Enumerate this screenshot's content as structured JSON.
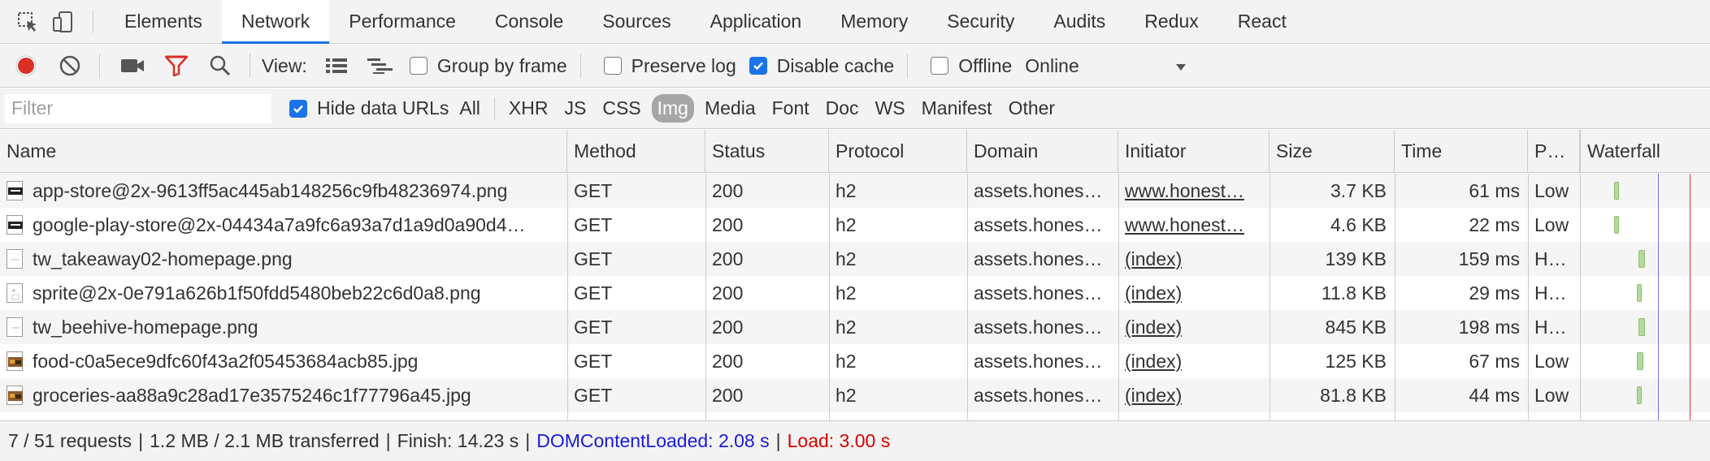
{
  "tabs": [
    {
      "label": "Elements"
    },
    {
      "label": "Network"
    },
    {
      "label": "Performance"
    },
    {
      "label": "Console"
    },
    {
      "label": "Sources"
    },
    {
      "label": "Application"
    },
    {
      "label": "Memory"
    },
    {
      "label": "Security"
    },
    {
      "label": "Audits"
    },
    {
      "label": "Redux"
    },
    {
      "label": "React"
    }
  ],
  "active_tab": "Network",
  "toolbar": {
    "view_label": "View:",
    "group_by_frame": "Group by frame",
    "preserve_log": "Preserve log",
    "disable_cache": "Disable cache",
    "offline": "Offline",
    "throttle_value": "Online",
    "group_by_frame_checked": false,
    "preserve_log_checked": false,
    "disable_cache_checked": true,
    "offline_checked": false
  },
  "filter": {
    "placeholder": "Filter",
    "hide_data_urls": "Hide data URLs",
    "hide_data_urls_checked": true,
    "types": [
      "All",
      "XHR",
      "JS",
      "CSS",
      "Img",
      "Media",
      "Font",
      "Doc",
      "WS",
      "Manifest",
      "Other"
    ],
    "active_type": "Img"
  },
  "columns": {
    "name": "Name",
    "method": "Method",
    "status": "Status",
    "protocol": "Protocol",
    "domain": "Domain",
    "initiator": "Initiator",
    "size": "Size",
    "time": "Time",
    "priority": "P…",
    "waterfall": "Waterfall"
  },
  "requests": [
    {
      "name": "app-store@2x-9613ff5ac445ab148256c9fb48236974.png",
      "method": "GET",
      "status": "200",
      "protocol": "h2",
      "domain": "assets.hones…",
      "initiator": "www.honest…",
      "initiator_link": true,
      "size": "3.7 KB",
      "time": "61 ms",
      "priority": "Low",
      "icon": "badge-thumbnail-icon"
    },
    {
      "name": "google-play-store@2x-04434a7a9fc6a93a7d1a9d0a90d4…",
      "method": "GET",
      "status": "200",
      "protocol": "h2",
      "domain": "assets.hones…",
      "initiator": "www.honest…",
      "initiator_link": true,
      "size": "4.6 KB",
      "time": "22 ms",
      "priority": "Low",
      "icon": "badge-thumbnail-icon"
    },
    {
      "name": "tw_takeaway02-homepage.png",
      "method": "GET",
      "status": "200",
      "protocol": "h2",
      "domain": "assets.hones…",
      "initiator": "(index)",
      "initiator_link": true,
      "size": "139 KB",
      "time": "159 ms",
      "priority": "H…",
      "icon": "blank-thumbnail-icon"
    },
    {
      "name": "sprite@2x-0e791a626b1f50fdd5480beb22c6d0a8.png",
      "method": "GET",
      "status": "200",
      "protocol": "h2",
      "domain": "assets.hones…",
      "initiator": "(index)",
      "initiator_link": true,
      "size": "11.8 KB",
      "time": "29 ms",
      "priority": "H…",
      "icon": "sprite-thumbnail-icon"
    },
    {
      "name": "tw_beehive-homepage.png",
      "method": "GET",
      "status": "200",
      "protocol": "h2",
      "domain": "assets.hones…",
      "initiator": "(index)",
      "initiator_link": true,
      "size": "845 KB",
      "time": "198 ms",
      "priority": "H…",
      "icon": "blank-thumbnail-icon"
    },
    {
      "name": "food-c0a5ece9dfc60f43a2f05453684acb85.jpg",
      "method": "GET",
      "status": "200",
      "protocol": "h2",
      "domain": "assets.hones…",
      "initiator": "(index)",
      "initiator_link": true,
      "size": "125 KB",
      "time": "67 ms",
      "priority": "Low",
      "icon": "photo-thumbnail-icon"
    },
    {
      "name": "groceries-aa88a9c28ad17e3575246c1f77796a45.jpg",
      "method": "GET",
      "status": "200",
      "protocol": "h2",
      "domain": "assets.hones…",
      "initiator": "(index)",
      "initiator_link": true,
      "size": "81.8 KB",
      "time": "44 ms",
      "priority": "Low",
      "icon": "photo-thumbnail-icon"
    }
  ],
  "status_bar": {
    "requests": "7 / 51 requests",
    "transferred": "1.2 MB / 2.1 MB transferred",
    "finish": "Finish: 14.23 s",
    "dom_content_loaded": "DOMContentLoaded: 2.08 s",
    "load": "Load: 3.00 s",
    "separator": "|"
  },
  "colors": {
    "accent": "#1a73e8",
    "record": "#d93025",
    "dom_content_loaded": "#1a1adb",
    "load": "#d90000",
    "waterfall_bar": "#b5d99c"
  }
}
